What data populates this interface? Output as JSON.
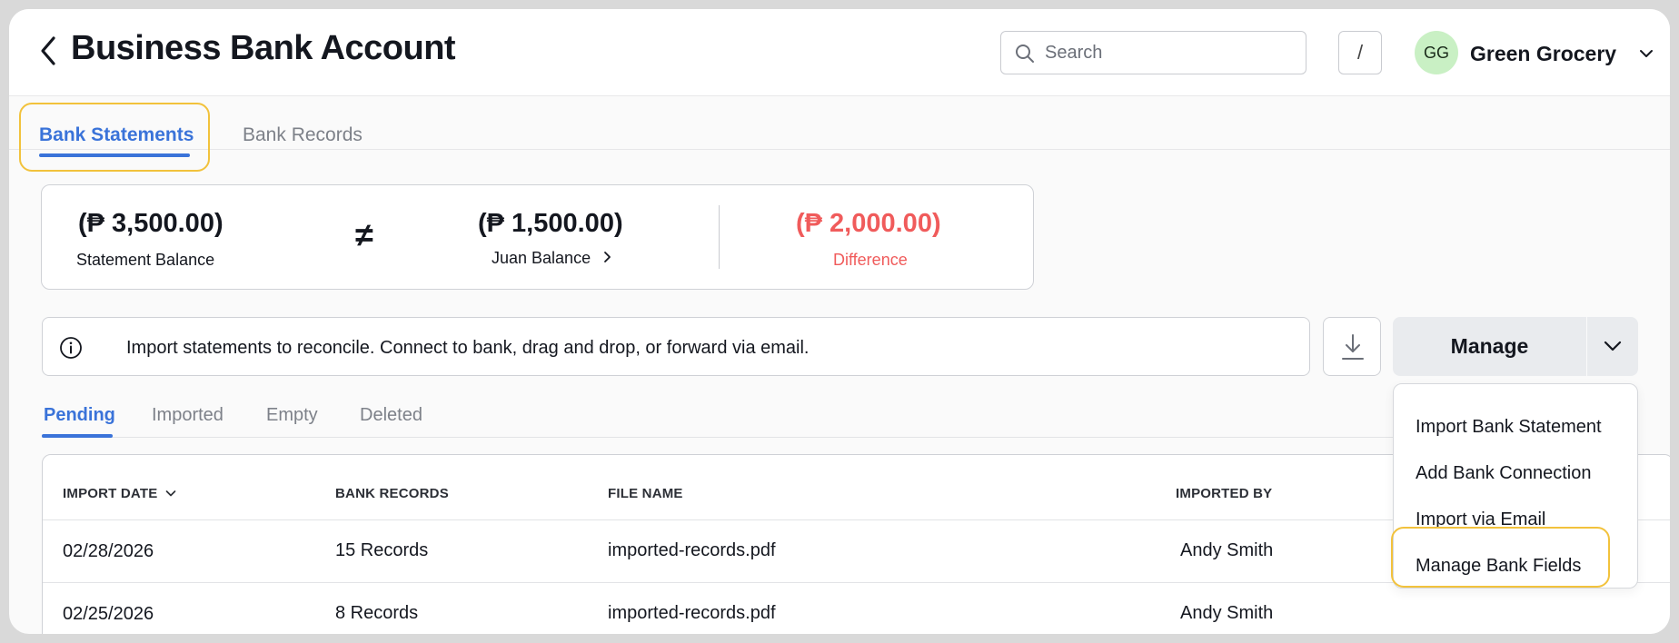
{
  "header": {
    "title": "Business Bank Account",
    "search_placeholder": "Search",
    "shortcut_key": "/",
    "avatar_initials": "GG",
    "org_name": "Green Grocery"
  },
  "tabs": [
    {
      "label": "Bank Statements",
      "active": true
    },
    {
      "label": "Bank Records",
      "active": false
    }
  ],
  "balance": {
    "statement_amount": "(₱ 3,500.00)",
    "statement_label": "Statement Balance",
    "juan_amount": "(₱ 1,500.00)",
    "juan_label": "Juan Balance",
    "difference_amount": "(₱ 2,000.00)",
    "difference_label": "Difference",
    "not_equal_symbol": "≠"
  },
  "info_message": "Import statements to reconcile. Connect to bank, drag and drop, or forward via email.",
  "manage_button": "Manage",
  "subtabs": [
    {
      "label": "Pending",
      "active": true
    },
    {
      "label": "Imported",
      "active": false
    },
    {
      "label": "Empty",
      "active": false
    },
    {
      "label": "Deleted",
      "active": false
    }
  ],
  "table": {
    "columns": [
      "IMPORT DATE",
      "BANK RECORDS",
      "FILE NAME",
      "IMPORTED BY"
    ],
    "rows": [
      {
        "date": "02/28/2026",
        "records": "15 Records",
        "file": "imported-records.pdf",
        "by": "Andy Smith"
      },
      {
        "date": "02/25/2026",
        "records": "8 Records",
        "file": "imported-records.pdf",
        "by": "Andy Smith"
      }
    ]
  },
  "manage_menu": [
    "Import Bank Statement",
    "Add Bank Connection",
    "Import via Email",
    "Manage Bank Fields"
  ],
  "colors": {
    "accent": "#3a73d9",
    "negative": "#f05b5b",
    "highlight": "#f2c23c",
    "avatar_bg": "#c9f0c4"
  }
}
